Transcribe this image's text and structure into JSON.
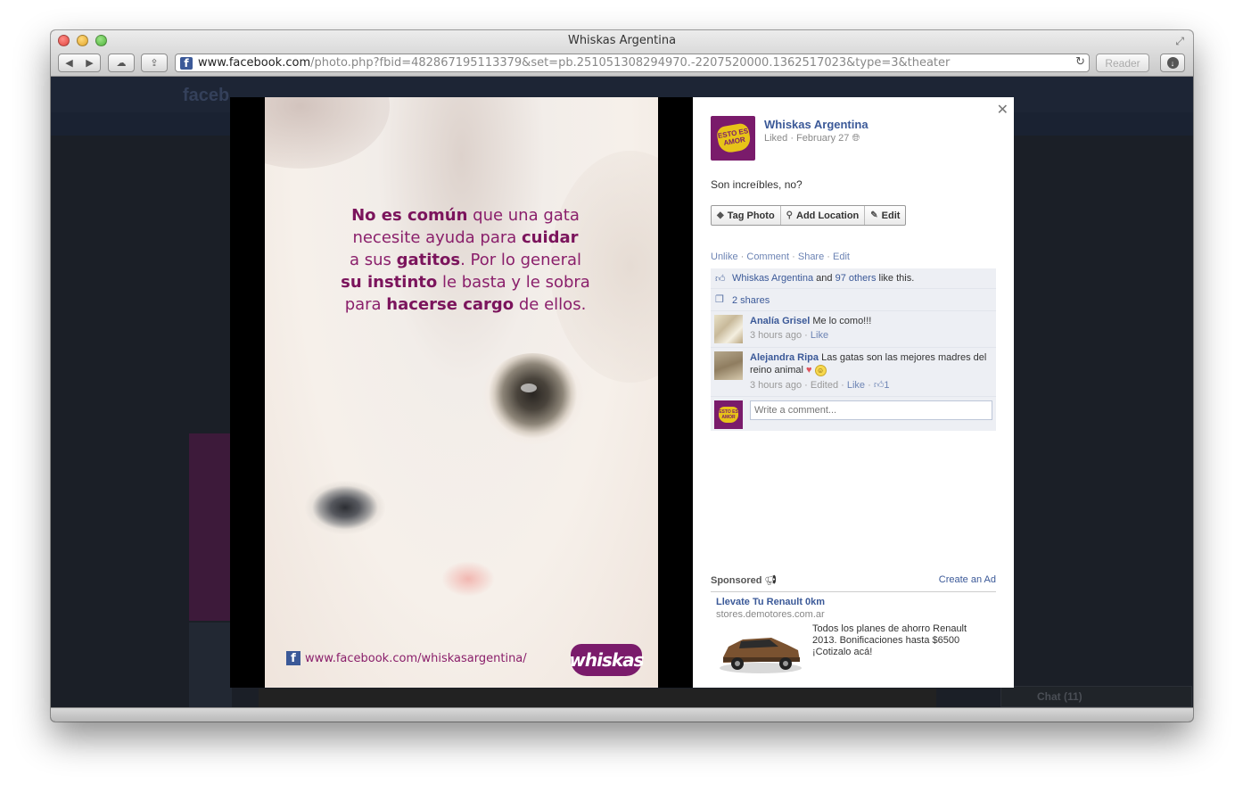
{
  "window": {
    "title": "Whiskas Argentina"
  },
  "toolbar": {
    "back_icon": "◀",
    "forward_icon": "▶",
    "cloud_icon": "☁",
    "share_icon": "⇪",
    "url_host": "www.facebook.com",
    "url_path": "/photo.php?fbid=482867195113379&set=pb.251051308294970.-2207520000.1362517023&type=3&theater",
    "reader_label": "Reader"
  },
  "background": {
    "logo": "faceb",
    "chat_label": "Chat (11)"
  },
  "photo": {
    "quote_line1_bold": "No es común",
    "quote_line1_rest": " que una gata",
    "quote_line2_pre": "necesite ayuda para ",
    "quote_line2_bold": "cuidar",
    "quote_line3_pre": "a sus ",
    "quote_line3_bold": "gatitos",
    "quote_line3_rest": ". Por lo general",
    "quote_line4_bold": "su instinto",
    "quote_line4_rest": " le basta y le sobra",
    "quote_line5_pre": "para ",
    "quote_line5_bold": "hacerse cargo",
    "quote_line5_rest": " de ellos.",
    "fb_url": "www.facebook.com/whiskasargentina/",
    "brand_logo": "whiskas"
  },
  "post": {
    "page_name": "Whiskas Argentina",
    "page_pic_text": "ESTO ES AMOR",
    "meta": "Liked · February 27",
    "caption": "Son increíbles, no?",
    "actions": [
      {
        "label": "Tag Photo",
        "icon": "tag-icon"
      },
      {
        "label": "Add Location",
        "icon": "map-pin-icon"
      },
      {
        "label": "Edit",
        "icon": "pencil-icon"
      }
    ],
    "links": {
      "unlike": "Unlike",
      "comment": "Comment",
      "share": "Share",
      "edit": "Edit"
    },
    "likes": {
      "name": "Whiskas Argentina",
      "and": " and ",
      "others": "97 others",
      "suffix": " like this."
    },
    "shares": "2 shares",
    "comments": [
      {
        "author": "Analía Grisel",
        "text": "Me lo como!!!",
        "time": "3 hours ago",
        "like": "Like"
      },
      {
        "author": "Alejandra Ripa",
        "text": "Las gatas son las mejores madres del reino animal",
        "time": "3 hours ago",
        "edited": "Edited",
        "like": "Like",
        "like_count": "1"
      }
    ],
    "comment_placeholder": "Write a comment..."
  },
  "sponsored": {
    "label": "Sponsored",
    "create_ad": "Create an Ad",
    "ad_title": "Llevate Tu Renault 0km",
    "ad_domain": "stores.demotores.com.ar",
    "ad_text": "Todos los planes de ahorro Renault 2013. Bonificaciones hasta $6500 ¡Cotizalo acá!"
  }
}
